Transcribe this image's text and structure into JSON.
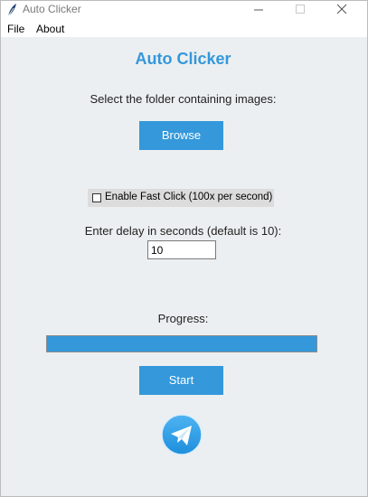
{
  "window": {
    "title": "Auto Clicker",
    "icon": "feather-icon"
  },
  "menu": {
    "items": [
      "File",
      "About"
    ]
  },
  "main": {
    "heading": "Auto Clicker",
    "folder_prompt": "Select the folder containing images:",
    "browse_label": "Browse",
    "fast_click": {
      "label": "Enable Fast Click (100x per second)",
      "checked": false
    },
    "delay_prompt": "Enter delay in seconds (default is 10):",
    "delay_value": "10",
    "progress_label": "Progress:",
    "progress": 1.0,
    "start_label": "Start",
    "telegram_icon": "telegram-icon"
  },
  "colors": {
    "accent": "#3498db",
    "background": "#eceff1"
  }
}
